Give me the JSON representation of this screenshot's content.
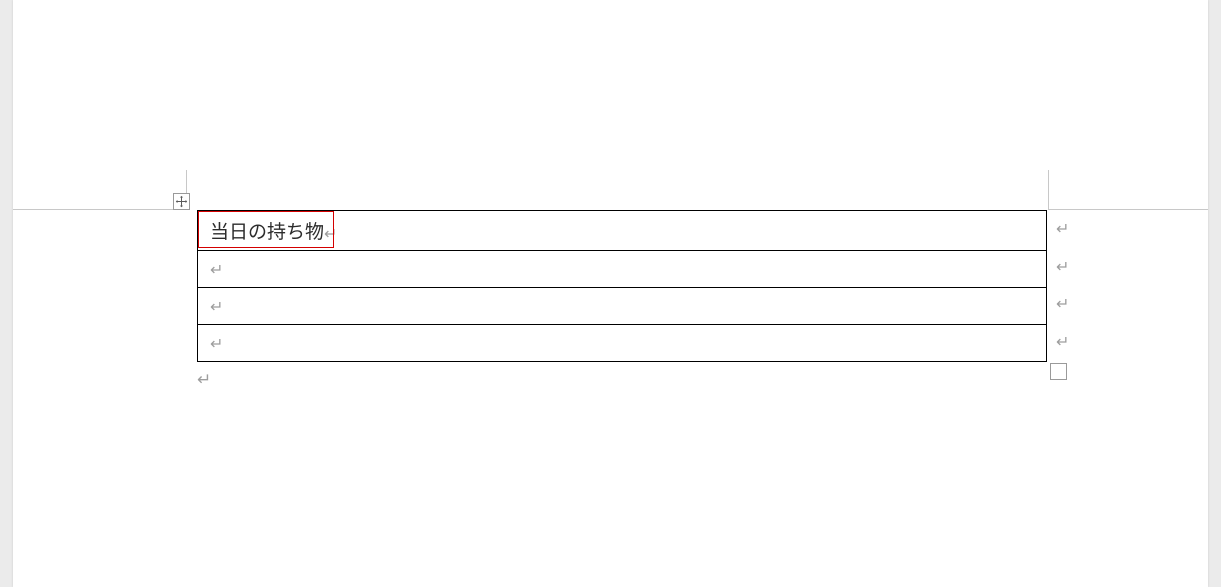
{
  "table": {
    "rows": [
      {
        "text": "当日の持ち物"
      },
      {
        "text": ""
      },
      {
        "text": ""
      },
      {
        "text": ""
      }
    ]
  },
  "marks": {
    "para": "↵",
    "rowend": "↵",
    "after": "↵"
  }
}
